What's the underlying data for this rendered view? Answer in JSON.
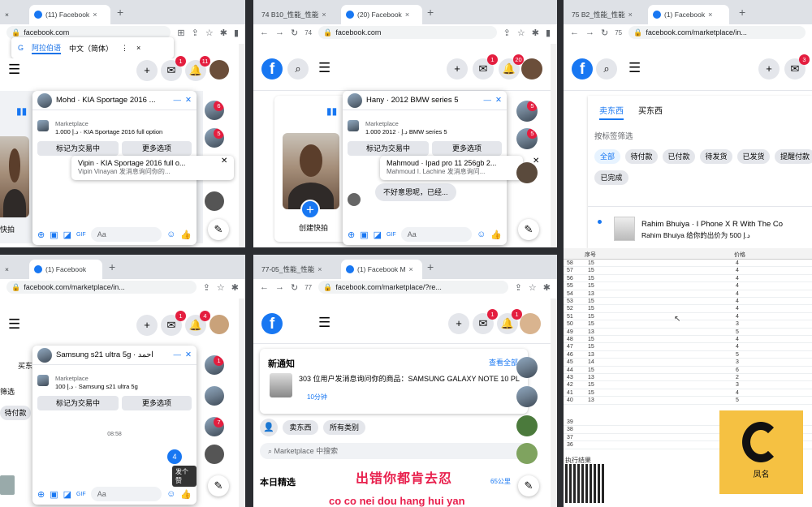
{
  "w1": {
    "tabs": [
      "",
      "(11) Facebook"
    ],
    "url": "facebook.com",
    "translate": {
      "original": "阿拉伯语",
      "target": "中文（简体）"
    },
    "badges": {
      "messenger": "1",
      "notif": "11"
    },
    "chat": {
      "title": "Mohd · KIA Sportage 2016 ...",
      "marketplace": "Marketplace",
      "listing": "1.000 د.إ · KIA Sportage 2016 full option",
      "mark_sold": "标记为交易中",
      "more": "更多选项",
      "notif_title": "Vipin · KIA Sportage 2016 full o...",
      "notif_sub": "Vipin Vinayan 发消息询问你的...",
      "input_placeholder": "Aa",
      "side_badges": [
        "6",
        "5"
      ]
    },
    "partial": {
      "send": "发表",
      "label": "快拍"
    }
  },
  "w2": {
    "tabs": [
      "74 B10_性能_性能",
      "(20) Facebook"
    ],
    "url_prefix": "74",
    "url": "facebook.com",
    "badges": {
      "messenger": "1",
      "notif": "20"
    },
    "story_label": "创建快拍",
    "chat": {
      "title": "Hany · 2012 BMW series 5",
      "marketplace": "Marketplace",
      "listing": "1.000 د.إ · 2012 BMW series 5",
      "mark_sold": "标记为交易中",
      "more": "更多选项",
      "notif_title": "Mahmoud · Ipad pro 11 256gb 2...",
      "notif_sub": "Mahmoud I. Lachine 发消息询问...",
      "reply": "不好意思呢，已经...",
      "input_placeholder": "Aa",
      "side_badges": [
        "5",
        "5"
      ]
    }
  },
  "w3": {
    "tabs": [
      "75 B2_性能_性能",
      "(1) Facebook"
    ],
    "url_prefix": "75",
    "url": "facebook.com/marketplace/in...",
    "badges": {
      "messenger": "3"
    },
    "tabs_inner": [
      "卖东西",
      "买东西"
    ],
    "filter_label": "按标签筛选",
    "pills": [
      "全部",
      "待付款",
      "已付款",
      "待发货",
      "已发货",
      "提醒付款",
      "已完成"
    ],
    "item": {
      "title": "Rahim Bhuiya · I Phone X R With The Co",
      "sub": "Rahim Bhuiya 给你的出价为 500 د.إ"
    }
  },
  "w4": {
    "tabs": [
      "",
      "(1) Facebook"
    ],
    "url": "facebook.com/marketplace/in...",
    "badges": {
      "messenger": "1",
      "notif": "4"
    },
    "chat": {
      "title": "Samsung s21 ultra 5g · احمد",
      "marketplace": "Marketplace",
      "listing": "100 د.إ · Samsung s21 ultra 5g",
      "mark_sold": "标记为交易中",
      "more": "更多选项",
      "time": "08:58",
      "msg": "4",
      "tooltip": "发个赞",
      "input_placeholder": "Aa",
      "side_badges": [
        "1",
        "7"
      ]
    },
    "partial": [
      "买东",
      "筛选",
      "待付款"
    ]
  },
  "w5": {
    "tabs": [
      "77-05_性能_性能",
      "(1) Facebook M"
    ],
    "url_prefix": "77",
    "url": "facebook.com/marketplace/?re...",
    "badges": {
      "messenger": "1",
      "notif": "1"
    },
    "notif_panel": {
      "title": "新通知",
      "see_all": "查看全部",
      "item": "303 位用户发消息询问你的商品：SAMSUNG GALAXY NOTE 10 PLUS",
      "time": "10分钟"
    },
    "chips": [
      "卖东西",
      "所有类别"
    ],
    "search_placeholder": "Marketplace 中搜索",
    "section": "本日精选",
    "distance": "65公里"
  },
  "sheet": {
    "headers": [
      "",
      "序号",
      "价格"
    ],
    "rows": [
      [
        "58",
        "15",
        "4"
      ],
      [
        "57",
        "15",
        "4"
      ],
      [
        "56",
        "15",
        "4"
      ],
      [
        "55",
        "15",
        "4"
      ],
      [
        "54",
        "13",
        "4"
      ],
      [
        "53",
        "15",
        "4"
      ],
      [
        "52",
        "15",
        "4"
      ],
      [
        "51",
        "15",
        "4"
      ],
      [
        "50",
        "15",
        "3"
      ],
      [
        "49",
        "13",
        "5"
      ],
      [
        "48",
        "15",
        "4"
      ],
      [
        "47",
        "15",
        "4"
      ],
      [
        "46",
        "13",
        "5"
      ],
      [
        "45",
        "14",
        "3"
      ],
      [
        "44",
        "15",
        "6"
      ],
      [
        "43",
        "13",
        "2"
      ],
      [
        "42",
        "15",
        "3"
      ],
      [
        "41",
        "15",
        "4"
      ],
      [
        "40",
        "13",
        "5"
      ]
    ],
    "tail": [
      "39",
      "38",
      "37",
      "36"
    ],
    "footer_label": "执行结果"
  },
  "overlay": {
    "wm_name": "凤名",
    "subtitle_cn": "出错你都肯去忍",
    "subtitle_py": "co co nei dou hang hui yan"
  },
  "colors": {
    "fb_blue": "#1877f2",
    "badge_red": "#e41e3f",
    "wm_yellow": "#f5c142",
    "sub_red": "#e8204d"
  }
}
